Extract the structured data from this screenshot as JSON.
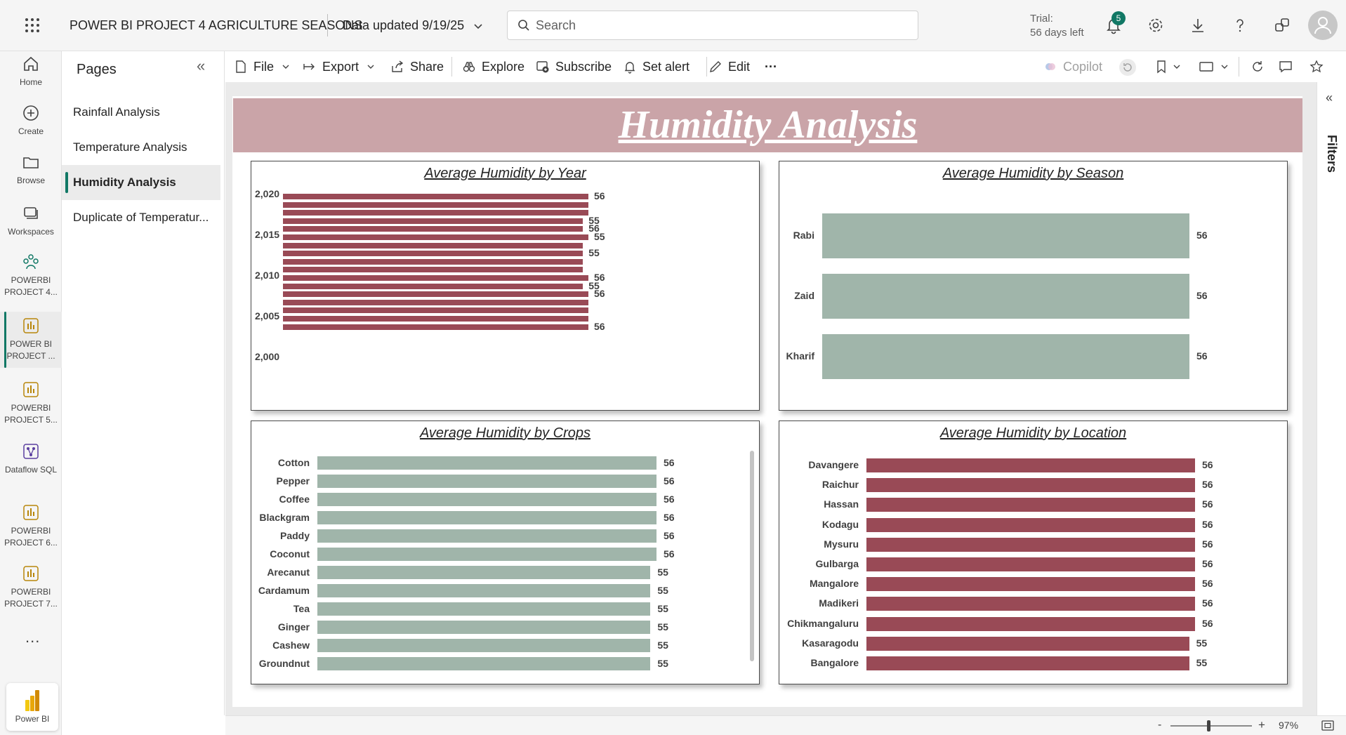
{
  "header": {
    "app_title": "POWER BI PROJECT 4 AGRICULTURE SEASONS",
    "data_updated": "Data updated 9/19/25",
    "search_placeholder": "Search",
    "trial_line1": "Trial:",
    "trial_line2": "56 days left",
    "notification_count": "5"
  },
  "rail": {
    "items": [
      {
        "label": "Home",
        "icon": "home-icon"
      },
      {
        "label": "Create",
        "icon": "plus-circle-icon"
      },
      {
        "label": "Browse",
        "icon": "folder-icon"
      },
      {
        "label": "Workspaces",
        "icon": "workspaces-icon"
      },
      {
        "label": "POWERBI PROJECT 4...",
        "icon": "workspace-people-icon"
      },
      {
        "label": "POWER BI PROJECT ...",
        "icon": "report-icon"
      },
      {
        "label": "POWERBI PROJECT 5...",
        "icon": "report-icon"
      },
      {
        "label": "Dataflow SQL",
        "icon": "dataflow-icon"
      },
      {
        "label": "POWERBI PROJECT 6...",
        "icon": "report-icon"
      },
      {
        "label": "POWERBI PROJECT 7...",
        "icon": "report-icon"
      }
    ],
    "more": "...",
    "bottom_app": "Power BI"
  },
  "pages": {
    "title": "Pages",
    "items": [
      {
        "label": "Rainfall Analysis"
      },
      {
        "label": "Temperature Analysis"
      },
      {
        "label": "Humidity Analysis"
      },
      {
        "label": "Duplicate of Temperatur..."
      }
    ]
  },
  "toolbar": {
    "file": "File",
    "export": "Export",
    "share": "Share",
    "explore": "Explore",
    "subscribe": "Subscribe",
    "set_alert": "Set alert",
    "edit": "Edit",
    "more": "···",
    "copilot": "Copilot"
  },
  "filters_pane": {
    "label": "Filters"
  },
  "report": {
    "title": "Humidity Analysis"
  },
  "status": {
    "zoom": "97%"
  },
  "colors": {
    "maroon": "#994a56",
    "sage": "#a0b5aa",
    "banner": "#caa4a8",
    "accent": "#117865"
  },
  "chart_data": [
    {
      "type": "bar",
      "title": "Average Humidity by Year",
      "orientation": "horizontal",
      "y_axis_ticks": [
        "2,020",
        "2,015",
        "2,010",
        "2,005",
        "2,000"
      ],
      "ylim": [
        2000,
        2020
      ],
      "categories": [
        2020,
        2019,
        2018,
        2017,
        2016,
        2015,
        2014,
        2013,
        2012,
        2011,
        2010,
        2009,
        2008,
        2007,
        2006,
        2005,
        2004
      ],
      "values": [
        56,
        56,
        56,
        55,
        55,
        56,
        55,
        55,
        55,
        55,
        56,
        55,
        56,
        56,
        56,
        56,
        56
      ],
      "data_labels": [
        "56",
        "",
        "",
        "55",
        "56",
        "55",
        "",
        "55",
        "",
        "",
        "56",
        "55",
        "56",
        "",
        "",
        "",
        "56"
      ],
      "color": "#994a56"
    },
    {
      "type": "bar",
      "title": "Average Humidity by Season",
      "orientation": "horizontal",
      "categories": [
        "Rabi",
        "Zaid",
        "Kharif"
      ],
      "values": [
        56,
        56,
        56
      ],
      "color": "#a0b5aa"
    },
    {
      "type": "bar",
      "title": "Average Humidity by Crops",
      "orientation": "horizontal",
      "categories": [
        "Cotton",
        "Pepper",
        "Coffee",
        "Blackgram",
        "Paddy",
        "Coconut",
        "Arecanut",
        "Cardamum",
        "Tea",
        "Ginger",
        "Cashew",
        "Groundnut"
      ],
      "values": [
        56,
        56,
        56,
        56,
        56,
        56,
        55,
        55,
        55,
        55,
        55,
        55
      ],
      "color": "#a0b5aa"
    },
    {
      "type": "bar",
      "title": "Average Humidity by Location",
      "orientation": "horizontal",
      "categories": [
        "Davangere",
        "Raichur",
        "Hassan",
        "Kodagu",
        "Mysuru",
        "Gulbarga",
        "Mangalore",
        "Madikeri",
        "Chikmangaluru",
        "Kasaragodu",
        "Bangalore"
      ],
      "values": [
        56,
        56,
        56,
        56,
        56,
        56,
        56,
        56,
        56,
        55,
        55
      ],
      "color": "#994a56"
    }
  ]
}
